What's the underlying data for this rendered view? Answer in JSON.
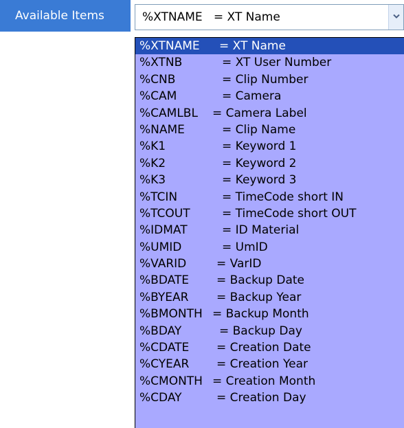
{
  "label": "Available Items",
  "combo": {
    "value": "%XTNAME   = XT Name"
  },
  "options": [
    {
      "code": "%XTNAME",
      "desc": "= XT Name",
      "selected": true
    },
    {
      "code": "%XTNB",
      "desc": "= XT User Number"
    },
    {
      "code": "%CNB",
      "desc": "= Clip Number"
    },
    {
      "code": "%CAM",
      "desc": "= Camera"
    },
    {
      "code": "%CAMLBL",
      "desc": "= Camera Label"
    },
    {
      "code": "%NAME",
      "desc": "= Clip Name"
    },
    {
      "code": "%K1",
      "desc": "= Keyword 1"
    },
    {
      "code": "%K2",
      "desc": "= Keyword 2"
    },
    {
      "code": "%K3",
      "desc": "= Keyword 3"
    },
    {
      "code": "%TCIN",
      "desc": "= TimeCode short IN"
    },
    {
      "code": "%TCOUT",
      "desc": "= TimeCode short OUT"
    },
    {
      "code": "%IDMAT",
      "desc": "= ID Material"
    },
    {
      "code": "%UMID",
      "desc": "= UmID"
    },
    {
      "code": "%VARID",
      "desc": "= VarID"
    },
    {
      "code": "%BDATE",
      "desc": "= Backup Date"
    },
    {
      "code": "%BYEAR",
      "desc": "= Backup Year"
    },
    {
      "code": "%BMONTH",
      "desc": "= Backup Month"
    },
    {
      "code": "%BDAY",
      "desc": "= Backup Day"
    },
    {
      "code": "%CDATE",
      "desc": "= Creation Date"
    },
    {
      "code": "%CYEAR",
      "desc": "= Creation Year"
    },
    {
      "code": "%CMONTH",
      "desc": "= Creation Month"
    },
    {
      "code": "%CDAY",
      "desc": "= Creation Day"
    }
  ],
  "colors": {
    "label_bg": "#3a7bd5",
    "dropdown_bg": "#a9a9ff",
    "selected_bg": "#2450b8"
  }
}
